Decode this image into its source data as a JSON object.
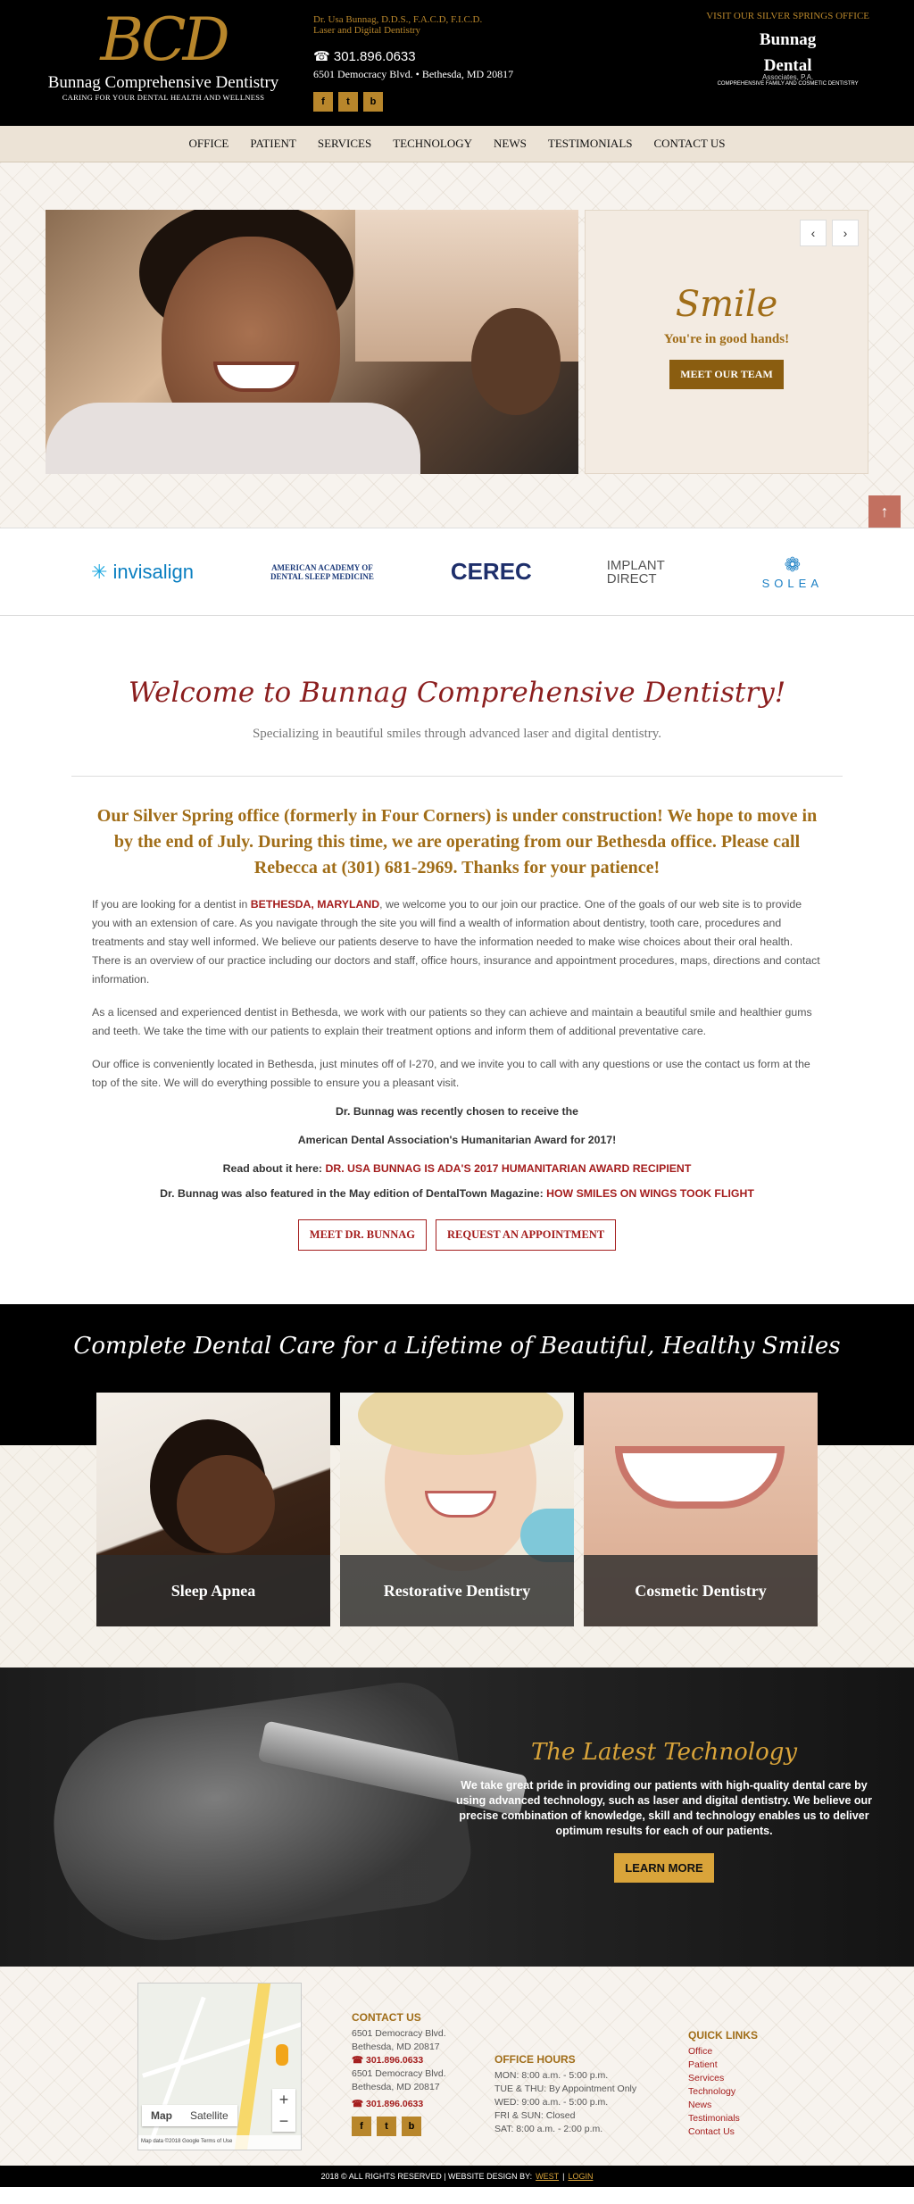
{
  "header": {
    "monogram": "BCD",
    "practice_name": "Bunnag Comprehensive Dentistry",
    "tagline": "CARING FOR YOUR DENTAL HEALTH AND WELLNESS",
    "doctor_line1": "Dr. Usa Bunnag, D.D.S., F.A.C.D, F.I.C.D.",
    "doctor_line2": "Laser and Digital Dentistry",
    "phone": "301.896.0633",
    "address": "6501 Democracy Blvd. • Bethesda, MD 20817",
    "social": [
      "f",
      "t",
      "b"
    ],
    "visit_link": "VISIT OUR SILVER SPRINGS OFFICE",
    "visit_logo_line1": "Bunnag",
    "visit_logo_line2": "Dental",
    "visit_logo_line3": "Associates, P.A.",
    "visit_logo_tag": "COMPREHENSIVE FAMILY AND COSMETIC DENTISTRY"
  },
  "nav": [
    "OFFICE",
    "PATIENT",
    "SERVICES",
    "TECHNOLOGY",
    "NEWS",
    "TESTIMONIALS",
    "CONTACT US"
  ],
  "hero": {
    "title": "Smile",
    "subtitle": "You're in good hands!",
    "button": "MEET OUR TEAM",
    "prev": "‹",
    "next": "›"
  },
  "logos": [
    "invisalign",
    "AMERICAN ACADEMY OF DENTAL SLEEP MEDICINE",
    "CEREC",
    "IMPLANT DIRECT",
    "SOLEA"
  ],
  "welcome": {
    "title": "Welcome to Bunnag Comprehensive Dentistry!",
    "tagline": "Specializing in beautiful smiles through advanced laser and digital dentistry.",
    "notice": "Our Silver Spring office (formerly in Four Corners) is under construction! We hope to move in by the end of July. During this time, we are operating from our Bethesda office. Please call Rebecca at (301) 681-2969. Thanks for your patience!",
    "p1_a": "If you are looking for a dentist in ",
    "p1_link": "BETHESDA, MARYLAND",
    "p1_b": ", we welcome you to our join our practice. One of the goals of our web site is to provide you with an extension of care. As you navigate through the site you will find a wealth of information about dentistry, tooth care, procedures and treatments and stay well informed. We believe our patients deserve to have the information needed to make wise choices about their oral health. There is an overview of our practice including our doctors and staff, office hours, insurance and appointment procedures, maps, directions and contact information.",
    "p2": "As a licensed and experienced dentist in Bethesda, we work with our patients so they can achieve and maintain a beautiful smile and healthier gums and teeth. We take the time with our patients to explain their treatment options and inform them of additional preventative care.",
    "p3": "Our office is conveniently located in Bethesda, just minutes off of I-270, and we invite you to call with any questions or use the contact us form at the top of the site. We will do everything possible to ensure you a pleasant visit.",
    "award1": "Dr. Bunnag was recently chosen to receive the",
    "award2": "American Dental Association's Humanitarian Award for 2017!",
    "read_label": "Read about it here: ",
    "read_link": "DR. USA BUNNAG IS ADA'S 2017 HUMANITARIAN AWARD RECIPIENT",
    "featured_label": "Dr. Bunnag was also featured in the May edition of DentalTown Magazine: ",
    "featured_link": "HOW SMILES ON WINGS TOOK FLIGHT",
    "btn_meet": "MEET DR. BUNNAG",
    "btn_request": "REQUEST AN APPOINTMENT"
  },
  "services": {
    "title": "Complete Dental Care for a Lifetime of Beautiful, Healthy Smiles",
    "cards": [
      "Sleep Apnea",
      "Restorative Dentistry",
      "Cosmetic Dentistry"
    ]
  },
  "tech": {
    "title": "The Latest Technology",
    "text": "We take great pride in providing our patients with high-quality dental care by using advanced technology, such as laser and digital dentistry. We believe our precise combination of knowledge, skill and technology enables us to deliver optimum results for each of our patients.",
    "button": "LEARN MORE"
  },
  "footer": {
    "map_tab_map": "Map",
    "map_tab_sat": "Satellite",
    "map_credit": "Map data ©2018 Google   Terms of Use",
    "contact_title": "CONTACT US",
    "addr1": "6501 Democracy Blvd.",
    "addr2": "Bethesda, MD 20817",
    "phone": "301.896.0633",
    "hours_title": "OFFICE HOURS",
    "hours": [
      "MON: 8:00 a.m. - 5:00 p.m.",
      "TUE & THU: By Appointment Only",
      "WED: 9:00 a.m. - 5:00 p.m.",
      "FRI & SUN: Closed",
      "SAT: 8:00 a.m. - 2:00 p.m."
    ],
    "links_title": "QUICK LINKS",
    "links": [
      "Office",
      "Patient",
      "Services",
      "Technology",
      "News",
      "Testimonials",
      "Contact Us"
    ],
    "copyright": "2018 © ALL RIGHTS RESERVED | WEBSITE DESIGN BY:",
    "design_by": "WEST",
    "sep": "|",
    "login": "LOGIN"
  }
}
